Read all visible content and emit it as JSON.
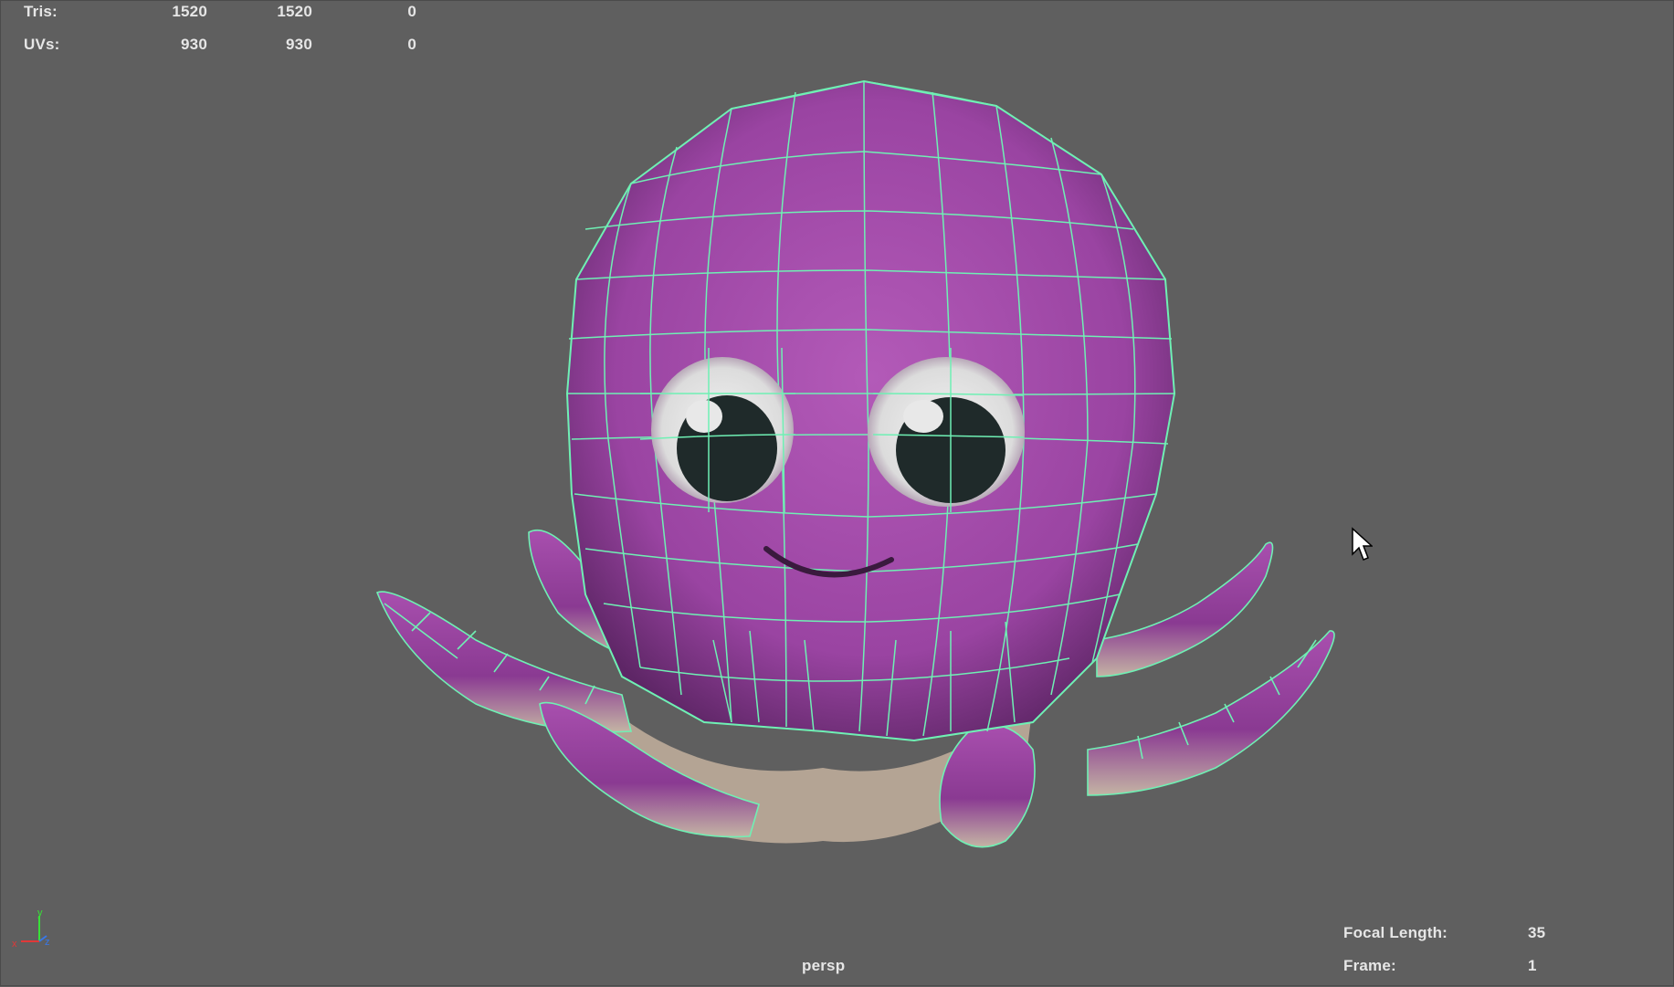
{
  "heads_up": {
    "rows": [
      {
        "label": "Tris:",
        "col1": "1520",
        "col2": "1520",
        "col3": "0"
      },
      {
        "label": "UVs:",
        "col1": "930",
        "col2": "930",
        "col3": "0"
      }
    ]
  },
  "camera": {
    "name": "persp",
    "focal_length_label": "Focal Length:",
    "focal_length_value": "35",
    "frame_label": "Frame:",
    "frame_value": "1"
  },
  "axis_labels": {
    "x": "x",
    "y": "y",
    "z": "z"
  },
  "colors": {
    "background": "#5f5f5f",
    "wireframe": "#6ff0b4",
    "body": "#a04aa8",
    "body_shadow": "#6a2a74",
    "underside": "#b8a898",
    "eye_white": "#e6e6e6",
    "pupil": "#1f2a2a"
  },
  "icons": [
    "mouse-cursor-icon",
    "view-axis-icon"
  ]
}
